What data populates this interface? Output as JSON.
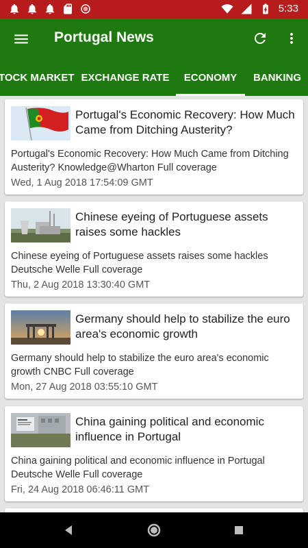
{
  "statusbar": {
    "time": "5:33",
    "icons_left": [
      "notification-bell-icon",
      "notification-bell-icon",
      "notification-bell-icon",
      "sd-card-icon",
      "record-icon"
    ],
    "icons_right": [
      "wifi-icon",
      "signal-icon",
      "battery-charging-icon"
    ]
  },
  "appbar": {
    "title": "Portugal News",
    "menu_icon": "hamburger-menu-icon",
    "refresh_icon": "refresh-icon",
    "more_icon": "more-vert-icon",
    "color": "#1e7a0e"
  },
  "tabs": [
    {
      "label": "TOCK MARKET",
      "selected": false
    },
    {
      "label": "EXCHANGE RATE",
      "selected": false
    },
    {
      "label": "ECONOMY",
      "selected": true
    },
    {
      "label": "BANKING",
      "selected": false
    }
  ],
  "articles": [
    {
      "headline": "Portugal's Economic Recovery: How Much Came from Ditching Austerity?",
      "summary": "Portugal's Economic Recovery: How Much Came from Ditching Austerity?  Knowledge@Wharton  Full coverage",
      "date": "Wed, 1 Aug 2018 17:54:09 GMT",
      "image": "portugal-flag-image"
    },
    {
      "headline": "Chinese eyeing of Portuguese assets raises some hackles",
      "summary": "Chinese eyeing of Portuguese assets raises some hackles  Deutsche Welle  Full coverage",
      "date": "Thu, 2 Aug 2018 13:30:40 GMT",
      "image": "power-plant-image"
    },
    {
      "headline": "Germany should help to stabilize the euro area's economic growth",
      "summary": "Germany should help to stabilize the euro area's economic growth  CNBC  Full coverage",
      "date": "Mon, 27 Aug 2018 03:55:10 GMT",
      "image": "brandenburg-gate-image"
    },
    {
      "headline": "China gaining political and economic influence in Portugal",
      "summary": "China gaining political and economic influence in Portugal  Deutsche Welle  Full coverage",
      "date": "Fri, 24 Aug 2018 06:46:11 GMT",
      "image": "building-sign-image"
    }
  ],
  "navbar": {
    "icons": [
      "back-icon",
      "home-icon",
      "recents-icon"
    ]
  }
}
